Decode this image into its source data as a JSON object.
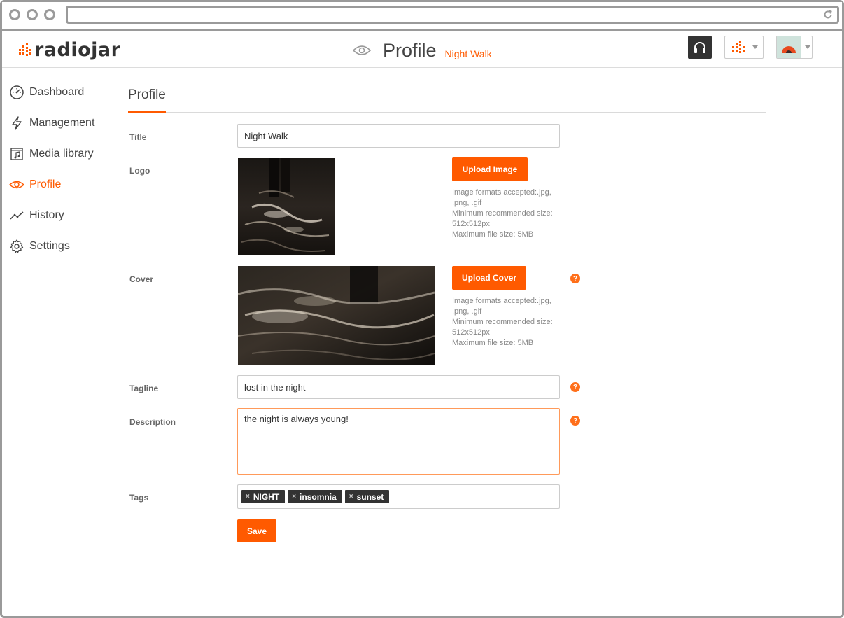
{
  "brand": {
    "name": "radiojar",
    "accent": "#ff5a00"
  },
  "header": {
    "title": "Profile",
    "subtitle": "Night Walk",
    "icons": [
      "eye-icon",
      "headphones-icon",
      "equalizer-icon",
      "avatar"
    ]
  },
  "sidebar": {
    "items": [
      {
        "label": "Dashboard",
        "icon": "speedometer-icon"
      },
      {
        "label": "Management",
        "icon": "lightning-icon"
      },
      {
        "label": "Media library",
        "icon": "music-file-icon"
      },
      {
        "label": "Profile",
        "icon": "eye-icon",
        "active": true
      },
      {
        "label": "History",
        "icon": "trend-line-icon"
      },
      {
        "label": "Settings",
        "icon": "gear-icon"
      }
    ]
  },
  "main": {
    "section_title": "Profile",
    "fields": {
      "title": {
        "label": "Title",
        "value": "Night Walk"
      },
      "logo": {
        "label": "Logo",
        "button": "Upload Image",
        "hint": [
          "Image formats accepted:.jpg,",
          ".png, .gif",
          "Minimum recommended size:",
          "512x512px",
          "Maximum file size: 5MB"
        ]
      },
      "cover": {
        "label": "Cover",
        "button": "Upload Cover",
        "hint": [
          "Image formats accepted:.jpg,",
          ".png, .gif",
          "Minimum recommended size:",
          "512x512px",
          "Maximum file size: 5MB"
        ]
      },
      "tagline": {
        "label": "Tagline",
        "value": "lost in the night"
      },
      "description": {
        "label": "Description",
        "value": "the night is always young!"
      },
      "tags": {
        "label": "Tags",
        "items": [
          "NIGHT",
          "insomnia",
          "sunset"
        ]
      }
    },
    "help_glyph": "?",
    "tag_remove_glyph": "×",
    "save_label": "Save"
  }
}
